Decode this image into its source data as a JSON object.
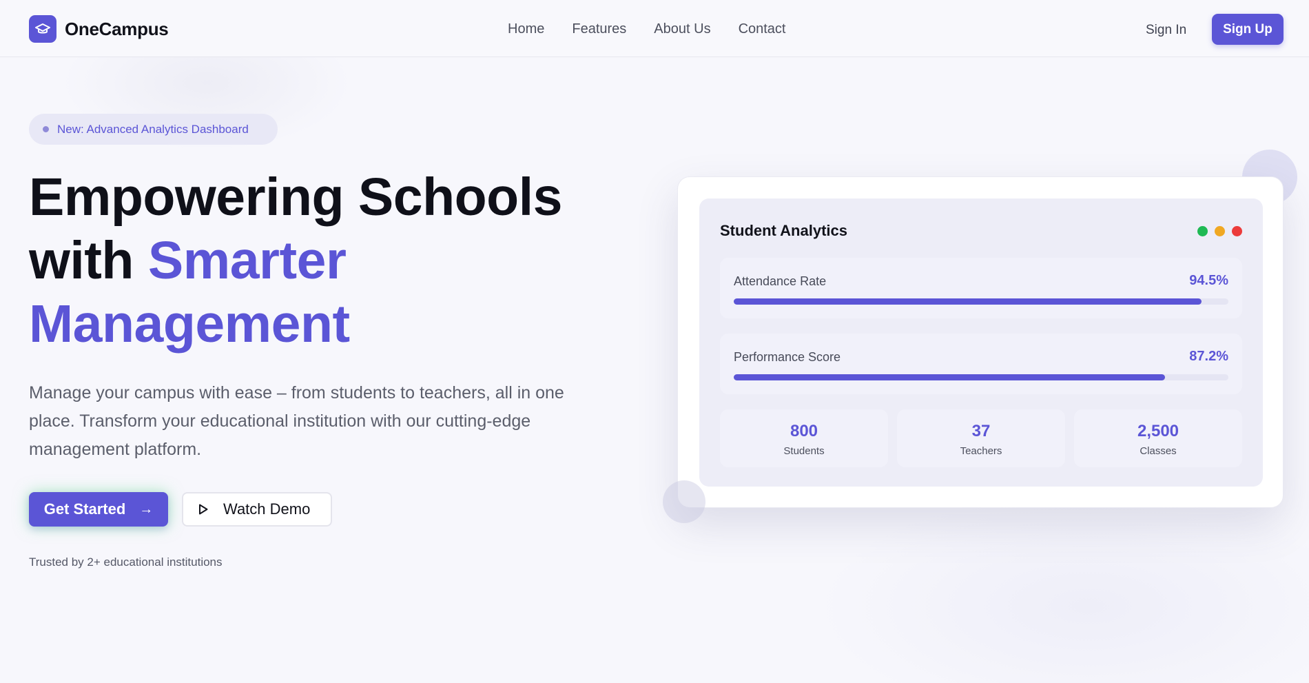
{
  "brand": {
    "name": "OneCampus",
    "logo_icon": "graduation-cap-icon"
  },
  "nav": {
    "links": [
      "Home",
      "Features",
      "About Us",
      "Contact"
    ],
    "sign_in": "Sign In",
    "sign_up": "Sign Up"
  },
  "hero": {
    "badge": "New: Advanced Analytics Dashboard",
    "headline_line1": "Empowering Schools",
    "headline_with": "with",
    "headline_accent1": "Smarter",
    "headline_accent2": "Management",
    "subtext": "Manage your campus with ease – from students to teachers, all in one place. Transform your educational institution with our cutting-edge management platform.",
    "cta_primary": "Get Started",
    "cta_secondary": "Watch Demo",
    "trusted": "Trusted by 2+ educational institutions"
  },
  "analytics": {
    "title": "Student Analytics",
    "window_dot_colors": [
      "#1fb954",
      "#f0a823",
      "#ec3b3b"
    ],
    "metrics": [
      {
        "label": "Attendance Rate",
        "value": "94.5%",
        "fill": 0.945
      },
      {
        "label": "Performance Score",
        "value": "87.2%",
        "fill": 0.872
      }
    ],
    "stats": [
      {
        "value": "800",
        "label": "Students"
      },
      {
        "value": "37",
        "label": "Teachers"
      },
      {
        "value": "2,500",
        "label": "Classes"
      }
    ]
  },
  "colors": {
    "accent": "#5b55d6",
    "background": "#f7f7fc"
  }
}
